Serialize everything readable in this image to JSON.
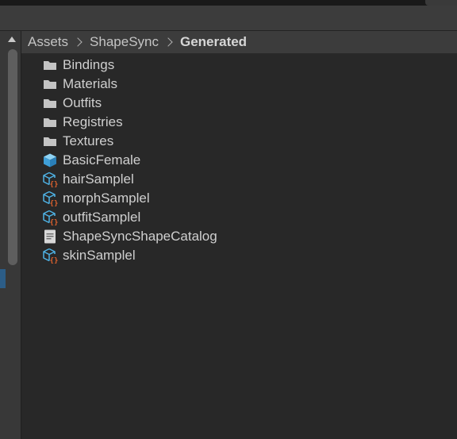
{
  "breadcrumb": {
    "items": [
      "Assets",
      "ShapeSync",
      "Generated"
    ]
  },
  "assets": {
    "items": [
      {
        "label": "Bindings",
        "icon": "folder-icon"
      },
      {
        "label": "Materials",
        "icon": "folder-icon"
      },
      {
        "label": "Outfits",
        "icon": "folder-icon"
      },
      {
        "label": "Registries",
        "icon": "folder-icon"
      },
      {
        "label": "Textures",
        "icon": "folder-icon"
      },
      {
        "label": "BasicFemale",
        "icon": "prefab-cube-icon"
      },
      {
        "label": "hairSamplel",
        "icon": "prefab-script-icon"
      },
      {
        "label": "morphSamplel",
        "icon": "prefab-script-icon"
      },
      {
        "label": "outfitSamplel",
        "icon": "prefab-script-icon"
      },
      {
        "label": "ShapeSyncShapeCatalog",
        "icon": "document-icon"
      },
      {
        "label": "skinSamplel",
        "icon": "prefab-script-icon"
      }
    ]
  },
  "colors": {
    "background": "#282828",
    "toolbar": "#3c3c3c",
    "prefab_blue": "#4fb3e6",
    "script_orange": "#e0622e",
    "selection_blue": "#2c5d87"
  }
}
